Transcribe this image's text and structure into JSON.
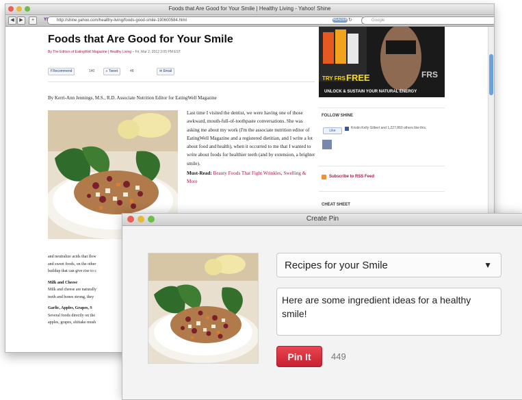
{
  "browser": {
    "window_title": "Foods that Are Good for Your Smile | Healthy Living - Yahoo! Shine",
    "url": "http://shine.yahoo.com/healthy-living/foods-good-smile-190600584.html",
    "rss_label": "READER",
    "search_placeholder": "Google"
  },
  "article": {
    "title": "Foods that Are Good for Your Smile",
    "byline_source": "By The Editors of EatingWell Magazine | Healthy Living",
    "byline_date": "– Fri, Mar 2, 2012 2:05 PM EST",
    "share": {
      "recommend_label": "Recommend",
      "recommend_count": "140",
      "tweet_label": "Tweet",
      "tweet_count": "48",
      "email_label": "Email"
    },
    "author_line": "By Kerri-Ann Jennings, M.S., R.D. Associate Nutrition Editor for EatingWell Magazine",
    "paragraph": "Last time I visited the dentist, we were having one of those awkward, mouth-full-of-toothpaste conversations. She was asking me about my work (I'm the associate nutrition editor of EatingWell Magazine and a registered dietitian, and I write a lot about food and health), when it occurred to me that I wanted to write about foods for healthier teeth (and by extension, a brighter smile).",
    "must_read_label": "Must-Read:",
    "must_read_link": "Beauty Foods That Fight Wrinkles, Swelling & More",
    "lower_lines": [
      "and neutralize acids that flow",
      "and sweet foods, on the other",
      "buildup that can give rise to c"
    ],
    "milk_heading": "Milk and Cheese",
    "milk_lines": [
      "Milk and cheese are naturally",
      "teeth and bones strong, they"
    ],
    "garlic_heading": "Garlic, Apples, Grapes, S",
    "garlic_lines": [
      "Several foods directly on the",
      "apples, grapes, shiitake mush"
    ]
  },
  "sidebar": {
    "ad_try": "TRY FRS",
    "ad_free": "FREE",
    "ad_brand": "FRS",
    "ad_tagline": "UNLOCK & SUSTAIN YOUR NATURAL ENERGY",
    "follow_heading": "FOLLOW SHINE",
    "like_label": "Like",
    "fb_text": "Kristin Kelly Gilbert and 1,227,860 others like this.",
    "rss_text": "Subscribe to RSS Feed",
    "cheat_heading": "CHEAT SHEET"
  },
  "dialog": {
    "title": "Create Pin",
    "board": "Recipes for your Smile",
    "description": "Here are some ingredient ideas for a healthy smile!",
    "pin_button": "Pin It",
    "char_count": "449"
  }
}
